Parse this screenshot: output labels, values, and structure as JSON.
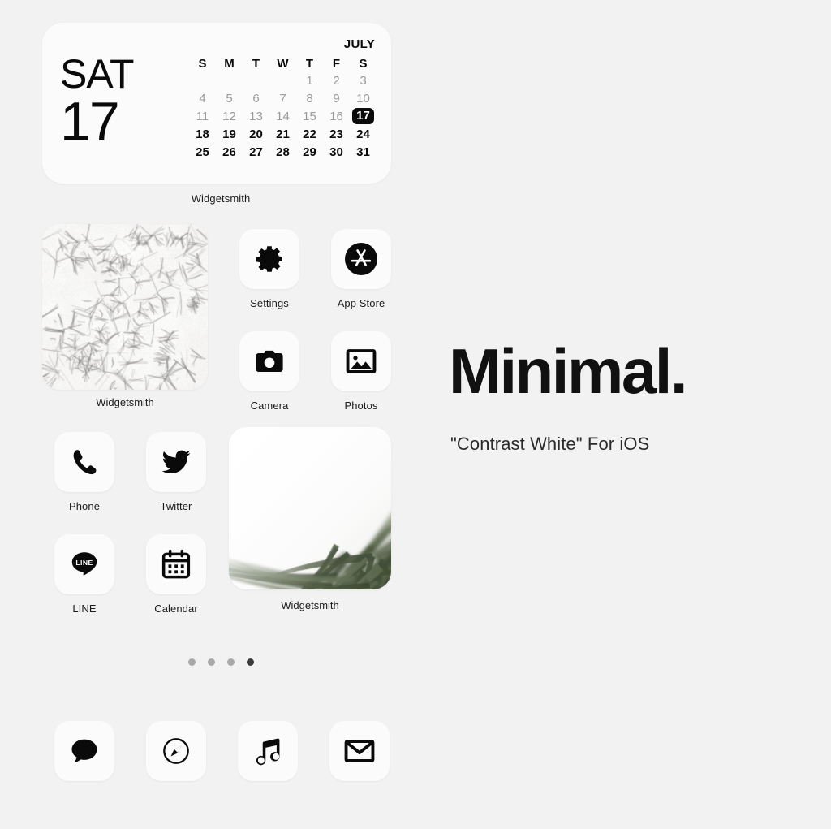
{
  "theme": {
    "background_color": "#f2f2f2",
    "tile_color": "#fbfbfb",
    "ink_color": "#0a0a0a",
    "muted_color": "#9b9b9b",
    "accent_color": "#0a0a0a"
  },
  "calendar_widget": {
    "weekday": "SAT",
    "day": "17",
    "month": "JULY",
    "day_headers": [
      "S",
      "M",
      "T",
      "W",
      "T",
      "F",
      "S"
    ],
    "leading_blanks": 4,
    "days": [
      {
        "n": "1",
        "state": "past"
      },
      {
        "n": "2",
        "state": "past"
      },
      {
        "n": "3",
        "state": "past"
      },
      {
        "n": "4",
        "state": "past"
      },
      {
        "n": "5",
        "state": "past"
      },
      {
        "n": "6",
        "state": "past"
      },
      {
        "n": "7",
        "state": "past"
      },
      {
        "n": "8",
        "state": "past"
      },
      {
        "n": "9",
        "state": "past"
      },
      {
        "n": "10",
        "state": "past"
      },
      {
        "n": "11",
        "state": "past"
      },
      {
        "n": "12",
        "state": "past"
      },
      {
        "n": "13",
        "state": "past"
      },
      {
        "n": "14",
        "state": "past"
      },
      {
        "n": "15",
        "state": "past"
      },
      {
        "n": "16",
        "state": "past"
      },
      {
        "n": "17",
        "state": "today"
      },
      {
        "n": "18",
        "state": "future"
      },
      {
        "n": "19",
        "state": "future"
      },
      {
        "n": "20",
        "state": "future"
      },
      {
        "n": "21",
        "state": "future"
      },
      {
        "n": "22",
        "state": "future"
      },
      {
        "n": "23",
        "state": "future"
      },
      {
        "n": "24",
        "state": "future"
      },
      {
        "n": "25",
        "state": "future"
      },
      {
        "n": "26",
        "state": "future"
      },
      {
        "n": "27",
        "state": "future"
      },
      {
        "n": "28",
        "state": "future"
      },
      {
        "n": "29",
        "state": "future"
      },
      {
        "n": "30",
        "state": "future"
      },
      {
        "n": "31",
        "state": "future"
      }
    ],
    "label": "Widgetsmith"
  },
  "photo_widgets": [
    {
      "id": "crack",
      "label": "Widgetsmith",
      "icon": "cracked-texture-photo"
    },
    {
      "id": "grass",
      "label": "Widgetsmith",
      "icon": "grass-blades-photo"
    }
  ],
  "apps": [
    {
      "label": "Settings",
      "icon": "gear-icon",
      "slot": "r1c2"
    },
    {
      "label": "App Store",
      "icon": "appstore-icon",
      "slot": "r1c3"
    },
    {
      "label": "Camera",
      "icon": "camera-icon",
      "slot": "r2c2"
    },
    {
      "label": "Photos",
      "icon": "photos-icon",
      "slot": "r2c3"
    },
    {
      "label": "Phone",
      "icon": "phone-icon",
      "slot": "r3c0"
    },
    {
      "label": "Twitter",
      "icon": "twitter-icon",
      "slot": "r3c1"
    },
    {
      "label": "LINE",
      "icon": "line-icon",
      "slot": "r4c0"
    },
    {
      "label": "Calendar",
      "icon": "calendar-icon",
      "slot": "r4c1"
    }
  ],
  "dock": [
    {
      "icon": "messages-icon"
    },
    {
      "icon": "safari-icon"
    },
    {
      "icon": "music-icon"
    },
    {
      "icon": "mail-icon"
    }
  ],
  "page_dots": {
    "count": 4,
    "active_index": 3
  },
  "promo": {
    "title": "Minimal.",
    "subtitle": "\"Contrast White\" For iOS"
  }
}
